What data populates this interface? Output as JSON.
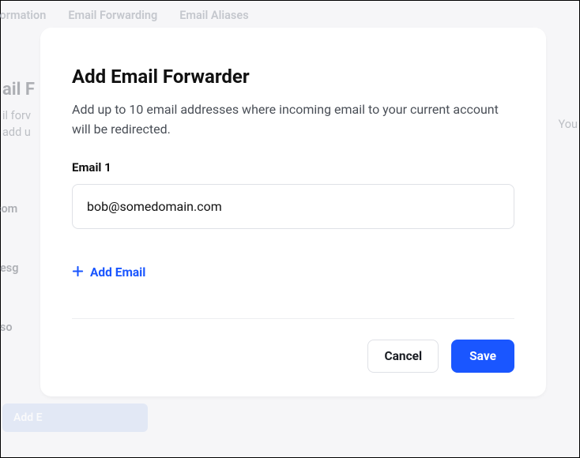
{
  "background": {
    "tabs": [
      "il Information",
      "Email Forwarding",
      "Email Aliases"
    ],
    "section_title": "ail F",
    "line1": "il forv",
    "line2": "add u",
    "emails": [
      "@som",
      "salesg",
      "ɪ@so"
    ],
    "add_button": "Add E",
    "right_text": "You"
  },
  "modal": {
    "title": "Add Email Forwarder",
    "subtitle": "Add up to 10 email addresses where incoming email to your current account will be redirected.",
    "field_label": "Email 1",
    "field_value": "bob@somedomain.com",
    "add_email_label": "Add Email",
    "cancel_label": "Cancel",
    "save_label": "Save"
  }
}
